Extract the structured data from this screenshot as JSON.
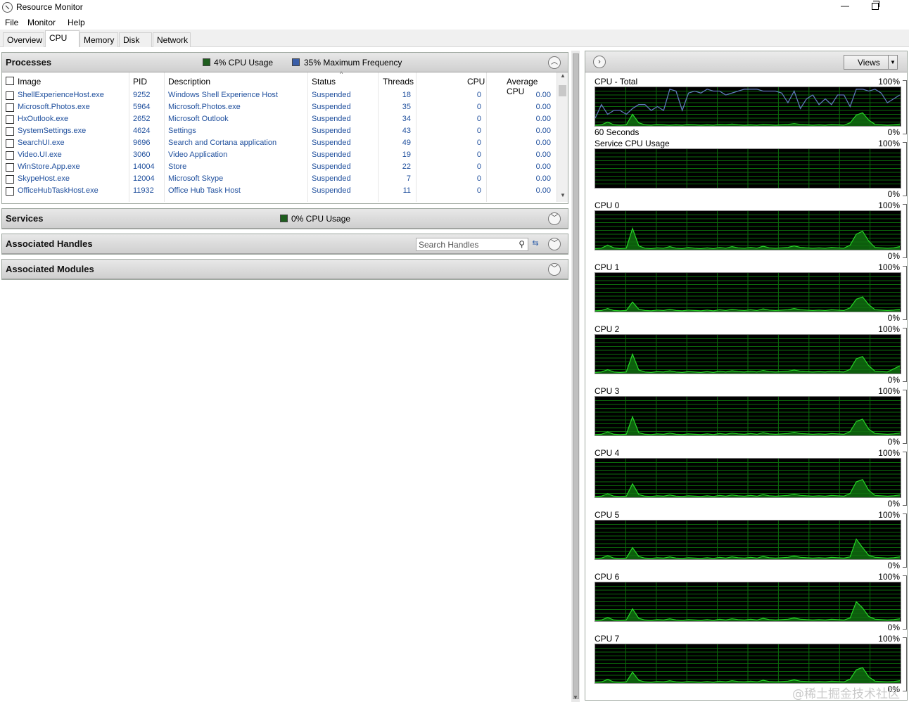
{
  "window": {
    "title": "Resource Monitor",
    "min_symbol": "—"
  },
  "menu": [
    "File",
    "Monitor",
    "Help"
  ],
  "tabs": [
    {
      "label": "Overview",
      "active": false
    },
    {
      "label": "CPU",
      "active": true
    },
    {
      "label": "Memory",
      "active": false
    },
    {
      "label": "Disk",
      "active": false
    },
    {
      "label": "Network",
      "active": false
    }
  ],
  "processes": {
    "title": "Processes",
    "cpu_usage": "4% CPU Usage",
    "max_frequency": "35% Maximum Frequency",
    "columns": [
      "Image",
      "PID",
      "Description",
      "Status",
      "Threads",
      "CPU",
      "Average CPU"
    ],
    "rows": [
      {
        "image": "ShellExperienceHost.exe",
        "pid": "9252",
        "description": "Windows Shell Experience Host",
        "status": "Suspended",
        "threads": "18",
        "cpu": "0",
        "avg_cpu": "0.00"
      },
      {
        "image": "Microsoft.Photos.exe",
        "pid": "5964",
        "description": "Microsoft.Photos.exe",
        "status": "Suspended",
        "threads": "35",
        "cpu": "0",
        "avg_cpu": "0.00"
      },
      {
        "image": "HxOutlook.exe",
        "pid": "2652",
        "description": "Microsoft Outlook",
        "status": "Suspended",
        "threads": "34",
        "cpu": "0",
        "avg_cpu": "0.00"
      },
      {
        "image": "SystemSettings.exe",
        "pid": "4624",
        "description": "Settings",
        "status": "Suspended",
        "threads": "43",
        "cpu": "0",
        "avg_cpu": "0.00"
      },
      {
        "image": "SearchUI.exe",
        "pid": "9696",
        "description": "Search and Cortana application",
        "status": "Suspended",
        "threads": "49",
        "cpu": "0",
        "avg_cpu": "0.00"
      },
      {
        "image": "Video.UI.exe",
        "pid": "3060",
        "description": "Video Application",
        "status": "Suspended",
        "threads": "19",
        "cpu": "0",
        "avg_cpu": "0.00"
      },
      {
        "image": "WinStore.App.exe",
        "pid": "14004",
        "description": "Store",
        "status": "Suspended",
        "threads": "22",
        "cpu": "0",
        "avg_cpu": "0.00"
      },
      {
        "image": "SkypeHost.exe",
        "pid": "12004",
        "description": "Microsoft Skype",
        "status": "Suspended",
        "threads": "7",
        "cpu": "0",
        "avg_cpu": "0.00"
      },
      {
        "image": "OfficeHubTaskHost.exe",
        "pid": "11932",
        "description": "Office Hub Task Host",
        "status": "Suspended",
        "threads": "11",
        "cpu": "0",
        "avg_cpu": "0.00"
      }
    ]
  },
  "services": {
    "title": "Services",
    "cpu_usage": "0% CPU Usage"
  },
  "handles": {
    "title": "Associated Handles",
    "search_placeholder": "Search Handles"
  },
  "modules": {
    "title": "Associated Modules"
  },
  "views": {
    "label": "Views"
  },
  "colors": {
    "cpu_legend": "#1e5e1e",
    "freq_legend": "#3a5ea8",
    "graph_line": "#27d627",
    "graph_freq": "#5d78b8",
    "link_text": "#1f4f9d"
  },
  "graphs": [
    {
      "title": "CPU - Total",
      "max": "100%",
      "min": "0%",
      "subtitle": "60 Seconds",
      "usage": [
        2,
        3,
        10,
        3,
        2,
        3,
        30,
        8,
        3,
        2,
        4,
        3,
        2,
        3,
        2,
        4,
        3,
        2,
        3,
        2,
        4,
        3,
        5,
        3,
        2,
        3,
        2,
        4,
        3,
        2,
        3,
        4,
        6,
        4,
        3,
        2,
        3,
        2,
        4,
        3,
        2,
        8,
        28,
        34,
        15,
        4,
        3,
        2,
        3,
        5
      ],
      "frequency": [
        20,
        55,
        30,
        40,
        40,
        30,
        45,
        55,
        55,
        40,
        50,
        40,
        95,
        90,
        40,
        85,
        90,
        85,
        95,
        90,
        90,
        80,
        85,
        90,
        95,
        95,
        95,
        90,
        90,
        90,
        85,
        60,
        90,
        45,
        70,
        80,
        55,
        70,
        55,
        80,
        80,
        50,
        95,
        95,
        90,
        95,
        85,
        60,
        70,
        80
      ]
    },
    {
      "title": "Service CPU Usage",
      "max": "100%",
      "min": "0%",
      "subtitle": "",
      "usage": [],
      "frequency": []
    },
    {
      "title": "CPU 0",
      "max": "100%",
      "min": "0%",
      "subtitle": "",
      "usage": [
        3,
        4,
        12,
        5,
        3,
        4,
        55,
        10,
        4,
        3,
        5,
        4,
        8,
        4,
        3,
        6,
        4,
        3,
        5,
        3,
        6,
        4,
        8,
        5,
        4,
        6,
        4,
        9,
        5,
        4,
        5,
        6,
        10,
        6,
        5,
        4,
        5,
        4,
        6,
        5,
        4,
        12,
        40,
        48,
        22,
        6,
        5,
        4,
        5,
        8
      ],
      "frequency": []
    },
    {
      "title": "CPU 1",
      "max": "100%",
      "min": "0%",
      "subtitle": "",
      "usage": [
        2,
        3,
        8,
        3,
        2,
        3,
        25,
        6,
        3,
        2,
        4,
        3,
        6,
        3,
        2,
        4,
        3,
        2,
        4,
        2,
        5,
        3,
        6,
        4,
        3,
        5,
        3,
        7,
        4,
        3,
        4,
        5,
        8,
        5,
        4,
        3,
        4,
        3,
        5,
        4,
        3,
        10,
        32,
        38,
        18,
        5,
        4,
        3,
        4,
        6
      ],
      "frequency": []
    },
    {
      "title": "CPU 2",
      "max": "100%",
      "min": "0%",
      "subtitle": "",
      "usage": [
        3,
        4,
        10,
        4,
        3,
        4,
        50,
        9,
        4,
        3,
        5,
        4,
        7,
        4,
        3,
        5,
        4,
        3,
        5,
        3,
        6,
        4,
        7,
        5,
        4,
        6,
        4,
        8,
        5,
        4,
        5,
        6,
        9,
        6,
        5,
        4,
        5,
        4,
        6,
        5,
        4,
        11,
        38,
        44,
        20,
        6,
        5,
        4,
        12,
        20
      ],
      "frequency": []
    },
    {
      "title": "CPU 3",
      "max": "100%",
      "min": "0%",
      "subtitle": "",
      "usage": [
        2,
        3,
        9,
        3,
        2,
        3,
        48,
        7,
        3,
        2,
        4,
        3,
        6,
        3,
        2,
        4,
        3,
        2,
        4,
        2,
        5,
        3,
        6,
        4,
        3,
        5,
        3,
        7,
        4,
        3,
        4,
        5,
        8,
        5,
        4,
        3,
        4,
        3,
        5,
        4,
        3,
        10,
        36,
        42,
        16,
        5,
        4,
        3,
        4,
        6
      ],
      "frequency": []
    },
    {
      "title": "CPU 4",
      "max": "100%",
      "min": "0%",
      "subtitle": "",
      "usage": [
        2,
        3,
        9,
        3,
        2,
        3,
        35,
        7,
        3,
        2,
        4,
        3,
        6,
        3,
        2,
        4,
        3,
        2,
        4,
        2,
        5,
        3,
        6,
        4,
        3,
        5,
        3,
        7,
        4,
        3,
        4,
        5,
        8,
        5,
        4,
        3,
        4,
        3,
        5,
        4,
        3,
        10,
        40,
        46,
        18,
        5,
        4,
        3,
        4,
        6
      ],
      "frequency": []
    },
    {
      "title": "CPU 5",
      "max": "100%",
      "min": "0%",
      "subtitle": "",
      "usage": [
        2,
        3,
        9,
        3,
        2,
        3,
        30,
        7,
        3,
        2,
        4,
        3,
        6,
        3,
        2,
        4,
        3,
        2,
        4,
        2,
        5,
        3,
        6,
        4,
        3,
        5,
        3,
        7,
        4,
        3,
        4,
        5,
        8,
        5,
        4,
        3,
        4,
        3,
        5,
        4,
        3,
        6,
        52,
        30,
        10,
        5,
        4,
        3,
        4,
        6
      ],
      "frequency": []
    },
    {
      "title": "CPU 6",
      "max": "100%",
      "min": "0%",
      "subtitle": "",
      "usage": [
        2,
        3,
        9,
        3,
        2,
        3,
        32,
        7,
        3,
        2,
        4,
        3,
        6,
        3,
        2,
        4,
        3,
        2,
        4,
        2,
        5,
        3,
        6,
        4,
        3,
        5,
        3,
        7,
        4,
        3,
        4,
        5,
        8,
        5,
        4,
        3,
        4,
        3,
        5,
        4,
        3,
        8,
        50,
        34,
        12,
        5,
        4,
        3,
        4,
        6
      ],
      "frequency": []
    },
    {
      "title": "CPU 7",
      "max": "100%",
      "min": "0%",
      "subtitle": "",
      "usage": [
        2,
        3,
        9,
        3,
        2,
        3,
        28,
        7,
        3,
        2,
        4,
        3,
        6,
        3,
        2,
        4,
        3,
        2,
        4,
        2,
        5,
        3,
        6,
        4,
        3,
        5,
        3,
        7,
        4,
        3,
        4,
        5,
        8,
        5,
        4,
        3,
        4,
        3,
        5,
        4,
        3,
        10,
        34,
        40,
        16,
        5,
        4,
        3,
        4,
        6
      ],
      "frequency": []
    }
  ],
  "watermark": "@稀土掘金技术社区"
}
